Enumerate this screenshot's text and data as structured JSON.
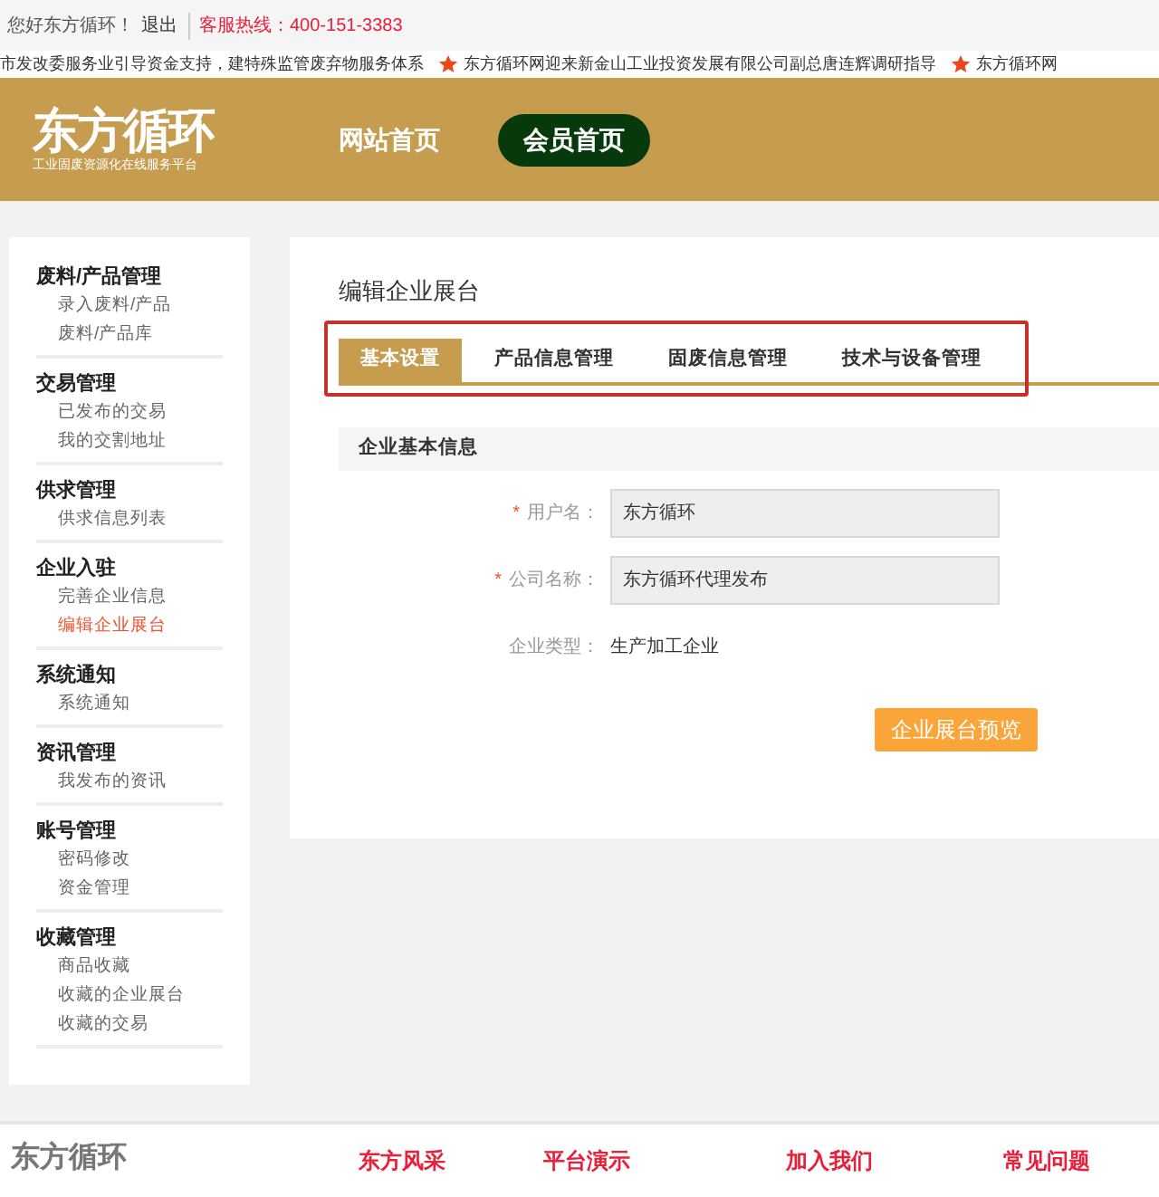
{
  "top_bar": {
    "greeting": "您好东方循环！",
    "logout": "退出",
    "hotline": "客服热线：400-151-3383"
  },
  "ticker": [
    "市发改委服务业引导资金支持，建特殊监管废弃物服务体系",
    "东方循环网迎来新金山工业投资发展有限公司副总唐连辉调研指导",
    "东方循环网"
  ],
  "header": {
    "logo": "东方循环",
    "logo_subtitle": "工业固废资源化在线服务平台",
    "nav": [
      {
        "label": "网站首页",
        "selected": false
      },
      {
        "label": "会员首页",
        "selected": true
      }
    ]
  },
  "sidebar": [
    {
      "title": "废料/产品管理",
      "items": [
        {
          "label": "录入废料/产品",
          "selected": false
        },
        {
          "label": "废料/产品库",
          "selected": false
        }
      ]
    },
    {
      "title": "交易管理",
      "items": [
        {
          "label": "已发布的交易",
          "selected": false
        },
        {
          "label": "我的交割地址",
          "selected": false
        }
      ]
    },
    {
      "title": "供求管理",
      "items": [
        {
          "label": "供求信息列表",
          "selected": false
        }
      ]
    },
    {
      "title": "企业入驻",
      "items": [
        {
          "label": "完善企业信息",
          "selected": false
        },
        {
          "label": "编辑企业展台",
          "selected": true
        }
      ]
    },
    {
      "title": "系统通知",
      "items": [
        {
          "label": "系统通知",
          "selected": false
        }
      ]
    },
    {
      "title": "资讯管理",
      "items": [
        {
          "label": "我发布的资讯",
          "selected": false
        }
      ]
    },
    {
      "title": "账号管理",
      "items": [
        {
          "label": "密码修改",
          "selected": false
        },
        {
          "label": "资金管理",
          "selected": false
        }
      ]
    },
    {
      "title": "收藏管理",
      "items": [
        {
          "label": "商品收藏",
          "selected": false
        },
        {
          "label": "收藏的企业展台",
          "selected": false
        },
        {
          "label": "收藏的交易",
          "selected": false
        }
      ]
    }
  ],
  "main": {
    "title": "编辑企业展台",
    "tabs": [
      {
        "label": "基本设置",
        "selected": true
      },
      {
        "label": "产品信息管理",
        "selected": false
      },
      {
        "label": "固废信息管理",
        "selected": false
      },
      {
        "label": "技术与设备管理",
        "selected": false
      }
    ],
    "section_title": "企业基本信息",
    "required_mark": "*",
    "fields": [
      {
        "kind": "input",
        "label": "用户名：",
        "required": true,
        "value": "东方循环"
      },
      {
        "kind": "input",
        "label": "公司名称：",
        "required": true,
        "value": "东方循环代理发布"
      },
      {
        "kind": "text",
        "label": "企业类型：",
        "required": false,
        "value": "生产加工企业"
      }
    ],
    "preview_button": "企业展台预览"
  },
  "footer": {
    "logo": "东方循环",
    "columns": [
      "东方风采",
      "平台演示",
      "加入我们",
      "常见问题"
    ]
  }
}
